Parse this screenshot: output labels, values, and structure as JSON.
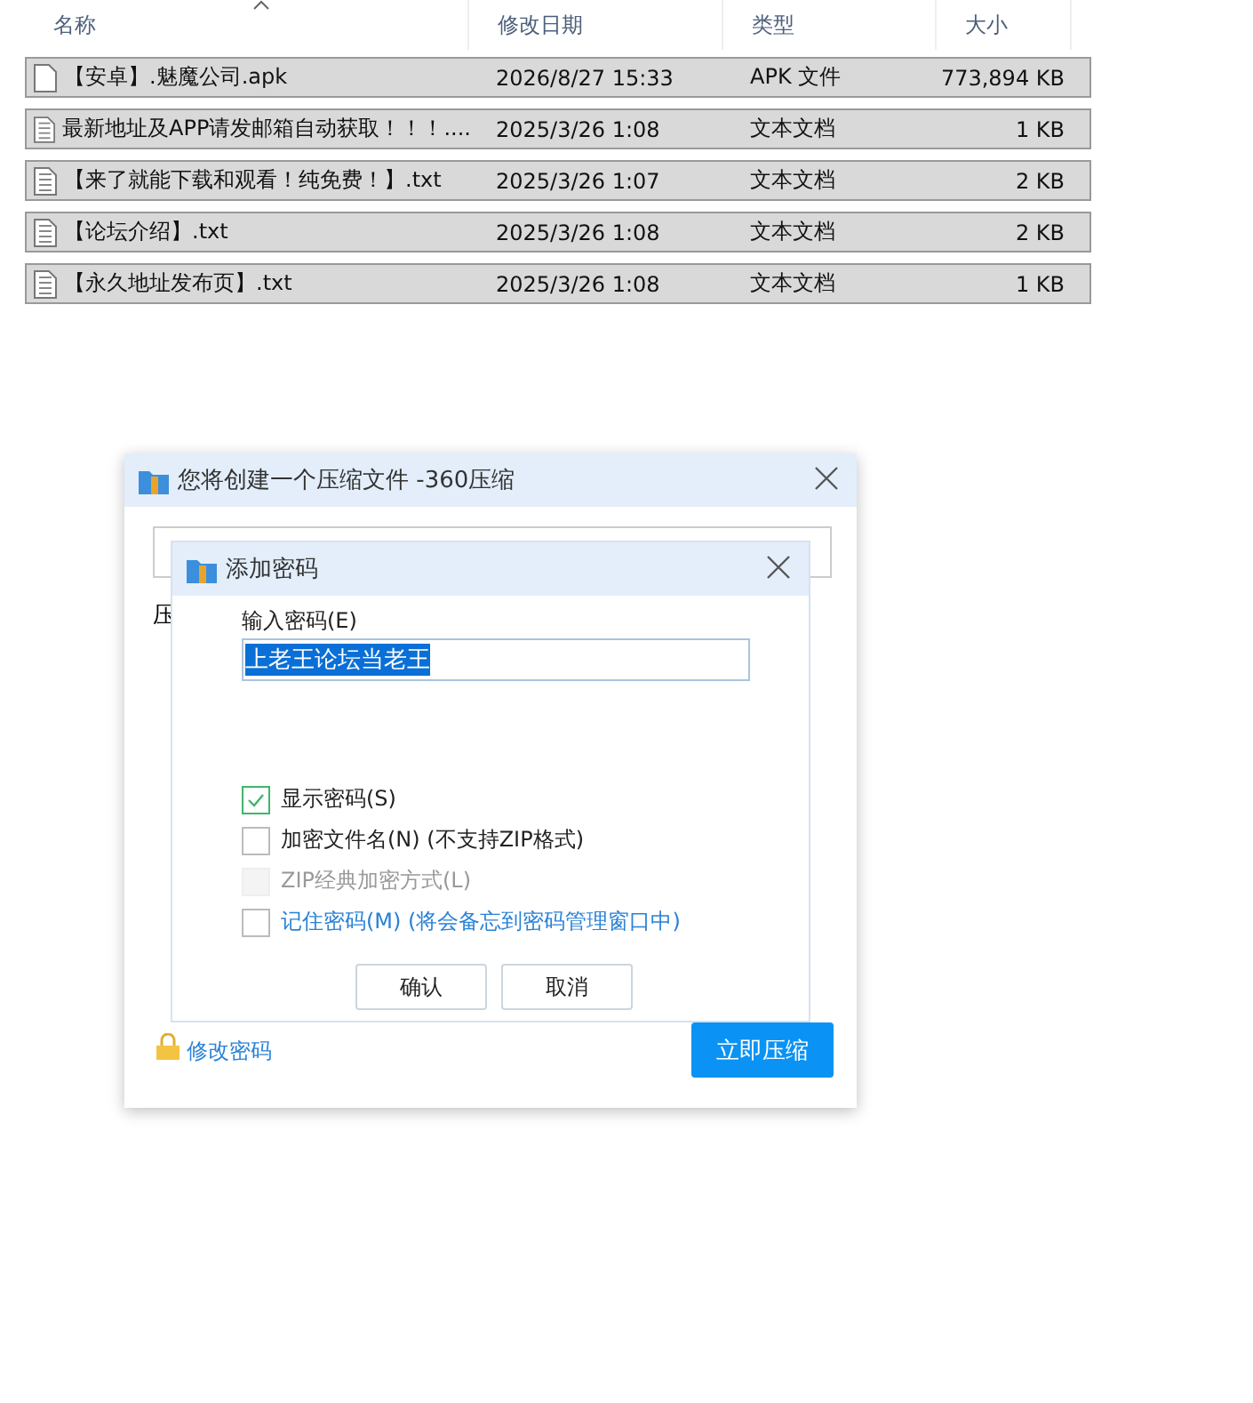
{
  "file_list": {
    "columns": [
      "名称",
      "修改日期",
      "类型",
      "大小"
    ],
    "rows": [
      {
        "kind": "blank",
        "name": "【安卓】.魅魔公司.apk",
        "date": "2026/8/27 15:33",
        "type": "APK 文件",
        "size": "773,894 KB",
        "selected": true
      },
      {
        "kind": "text",
        "name": "最新地址及APP请发邮箱自动获取！！！....",
        "date": "2025/3/26 1:08",
        "type": "文本文档",
        "size": "1 KB",
        "selected": true
      },
      {
        "kind": "text",
        "name": "【来了就能下载和观看！纯免费！】.txt",
        "date": "2025/3/26 1:07",
        "type": "文本文档",
        "size": "2 KB",
        "selected": true
      },
      {
        "kind": "text",
        "name": "【论坛介绍】.txt",
        "date": "2025/3/26 1:08",
        "type": "文本文档",
        "size": "2 KB",
        "selected": true
      },
      {
        "kind": "text",
        "name": "【永久地址发布页】.txt",
        "date": "2025/3/26 1:08",
        "type": "文本文档",
        "size": "1 KB",
        "selected": true
      }
    ]
  },
  "compress_dialog": {
    "title": "您将创建一个压缩文件 -360压缩",
    "label": "压",
    "change_password_link": "修改密码",
    "compress_button": "立即压缩"
  },
  "password_dialog": {
    "title": "添加密码",
    "field_label": "输入密码(E)",
    "password": "上老王论坛当老王",
    "options": [
      {
        "label": "显示密码(S)",
        "checked": true,
        "disabled": false,
        "link": false
      },
      {
        "label": "加密文件名(N) (不支持ZIP格式)",
        "checked": false,
        "disabled": false,
        "link": false
      },
      {
        "label": "ZIP经典加密方式(L)",
        "checked": false,
        "disabled": true,
        "link": false
      },
      {
        "label": "记住密码(M) (将会备忘到密码管理窗口中)",
        "checked": false,
        "disabled": false,
        "link": true
      }
    ],
    "buttons": [
      "确认",
      "取消"
    ]
  }
}
